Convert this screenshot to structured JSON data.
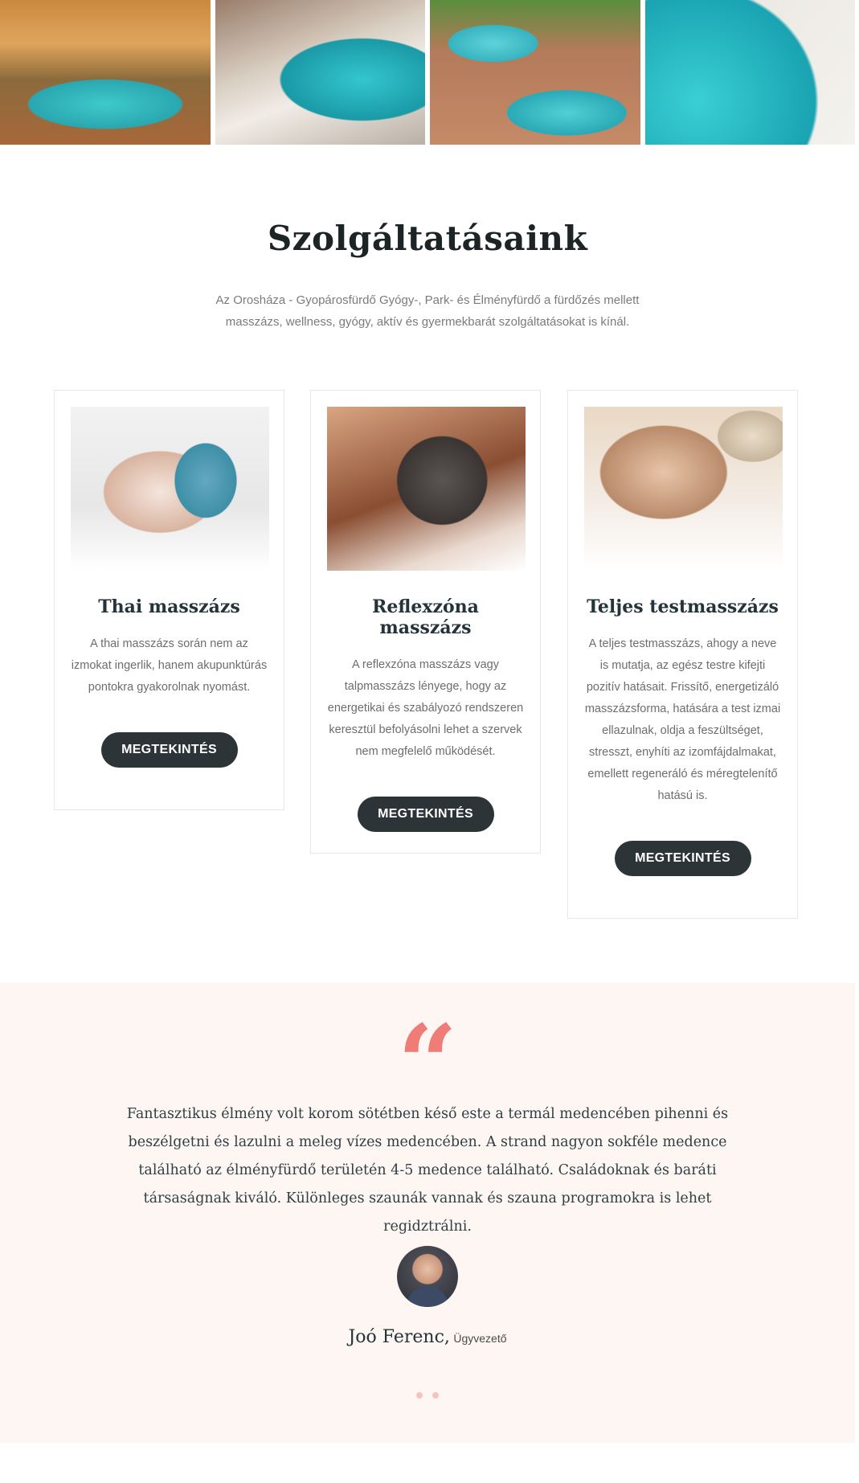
{
  "gallery": {
    "images": [
      {
        "alt": "indoor-pool-photo"
      },
      {
        "alt": "towels-pool-photo"
      },
      {
        "alt": "outdoor-pools-photo"
      },
      {
        "alt": "swimmers-pool-photo"
      }
    ]
  },
  "services": {
    "title": "Szolgáltatásaink",
    "description": "Az Orosháza - Gyopárosfürdő Gyógy-, Park- és Élményfürdő a fürdőzés mellett masszázs, wellness, gyógy, aktív és gyermekbarát szolgáltatásokat is kínál.",
    "cards": [
      {
        "title": "Thai masszázs",
        "text": "A thai masszázs során nem az izmokat ingerlik, hanem akupunktúrás pontokra gyakorolnak nyomást.",
        "button": "MEGTEKINTÉS"
      },
      {
        "title": "Reflexzóna masszázs",
        "text": "A reflexzóna masszázs vagy talpmasszázs lényege, hogy az energetikai és szabályozó rendszeren keresztül befolyásolni lehet a szervek nem megfelelő működését.",
        "button": "MEGTEKINTÉS"
      },
      {
        "title": "Teljes testmasszázs",
        "text": "A teljes testmasszázs, ahogy a neve is mutatja, az egész testre kifejti pozitív hatásait. Frissítő, energetizáló masszázsforma, hatására a test izmai ellazulnak, oldja a feszültséget, stresszt, enyhíti az izomfájdalmakat, emellett regeneráló és méregtelenítő hatású is.",
        "button": "MEGTEKINTÉS"
      }
    ]
  },
  "testimonial": {
    "quote_mark": "“",
    "text": "Fantasztikus élmény volt korom sötétben késő este a termál medencében pihenni és beszélgetni és lazulni a meleg vízes medencében. A strand nagyon sokféle medence található az élményfürdő területén 4-5 medence található. Családoknak és baráti társaságnak kiváló. Különleges szaunák vannak és szauna programokra is lehet regidztrálni.",
    "author_name": "Joó Ferenc,",
    "author_role": "Ügyvezető",
    "slides": 2,
    "accent_color": "#ef7c76"
  },
  "colors": {
    "button_bg": "#2c3437",
    "testimonial_bg": "#fdf6f3",
    "heading": "#1d2426"
  }
}
